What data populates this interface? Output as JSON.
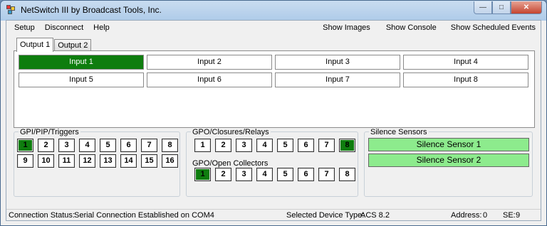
{
  "window": {
    "title": "NetSwitch III by Broadcast Tools, Inc."
  },
  "menu": {
    "left": [
      "Setup",
      "Disconnect",
      "Help"
    ],
    "right": [
      "Show Images",
      "Show Console",
      "Show Scheduled Events"
    ]
  },
  "tabs": [
    {
      "label": "Output 1",
      "active": true
    },
    {
      "label": "Output 2",
      "active": false
    }
  ],
  "inputs": [
    {
      "label": "Input 1",
      "active": true
    },
    {
      "label": "Input 2",
      "active": false
    },
    {
      "label": "Input 3",
      "active": false
    },
    {
      "label": "Input 4",
      "active": false
    },
    {
      "label": "Input 5",
      "active": false
    },
    {
      "label": "Input 6",
      "active": false
    },
    {
      "label": "Input 7",
      "active": false
    },
    {
      "label": "Input 8",
      "active": false
    }
  ],
  "gpi": {
    "title": "GPI/PIP/Triggers",
    "buttons": [
      "1",
      "2",
      "3",
      "4",
      "5",
      "6",
      "7",
      "8",
      "9",
      "10",
      "11",
      "12",
      "13",
      "14",
      "15",
      "16"
    ],
    "active": [
      "1"
    ]
  },
  "relays": {
    "title": "GPO/Closures/Relays",
    "buttons": [
      "1",
      "2",
      "3",
      "4",
      "5",
      "6",
      "7",
      "8"
    ],
    "active": [
      "8"
    ]
  },
  "collectors": {
    "title": "GPO/Open Collectors",
    "buttons": [
      "1",
      "2",
      "3",
      "4",
      "5",
      "6",
      "7",
      "8"
    ],
    "active": [
      "1"
    ]
  },
  "sensors": {
    "title": "Silence Sensors",
    "items": [
      "Silence Sensor 1",
      "Silence Sensor 2"
    ]
  },
  "status": {
    "connection_label": "Connection Status:",
    "connection_value": "Serial Connection Established on COM4",
    "device_label": "Selected Device Type:",
    "device_value": "ACS 8.2",
    "address_label": "Address:",
    "address_value": "0",
    "se_label": "SE:",
    "se_value": "9"
  },
  "colors": {
    "active_green": "#0e7d0e",
    "sensor_green": "#8deb8d"
  }
}
